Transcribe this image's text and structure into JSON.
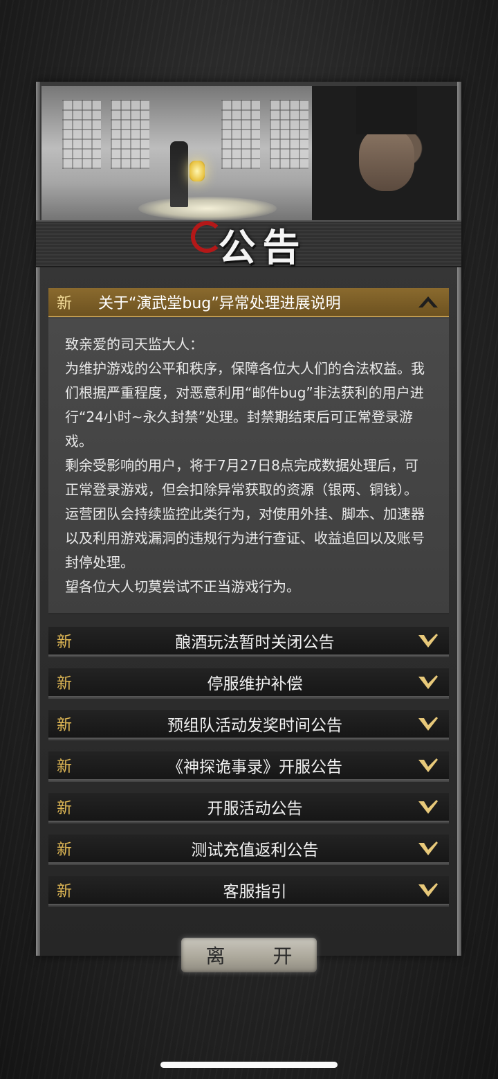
{
  "header": {
    "title": "公告"
  },
  "announcements": [
    {
      "badge": "新",
      "title": "关于“演武堂bug”异常处理进展说明",
      "expanded": true,
      "content": [
        "致亲爱的司天监大人：",
        "为维护游戏的公平和秩序，保障各位大人们的合法权益。我们根据严重程度，对恶意利用“邮件bug”非法获利的用户进行“24小时~永久封禁”处理。封禁期结束后可正常登录游戏。",
        "剩余受影响的用户，将于7月27日8点完成数据处理后，可正常登录游戏，但会扣除异常获取的资源（银两、铜钱）。",
        "运营团队会持续监控此类行为，对使用外挂、脚本、加速器以及利用游戏漏洞的违规行为进行查证、收益追回以及账号封停处理。",
        "望各位大人切莫尝试不正当游戏行为。"
      ]
    },
    {
      "badge": "新",
      "title": "酿酒玩法暂时关闭公告",
      "expanded": false
    },
    {
      "badge": "新",
      "title": "停服维护补偿",
      "expanded": false
    },
    {
      "badge": "新",
      "title": "预组队活动发奖时间公告",
      "expanded": false
    },
    {
      "badge": "新",
      "title": "《神探诡事录》开服公告",
      "expanded": false
    },
    {
      "badge": "新",
      "title": "开服活动公告",
      "expanded": false
    },
    {
      "badge": "新",
      "title": "测试充值返利公告",
      "expanded": false
    },
    {
      "badge": "新",
      "title": "客服指引",
      "expanded": false
    }
  ],
  "footer": {
    "leave_label": "离 开"
  },
  "colors": {
    "accent_gold": "#8a6a2e",
    "badge_gold": "#e0b855",
    "seal_red": "#b41818"
  }
}
